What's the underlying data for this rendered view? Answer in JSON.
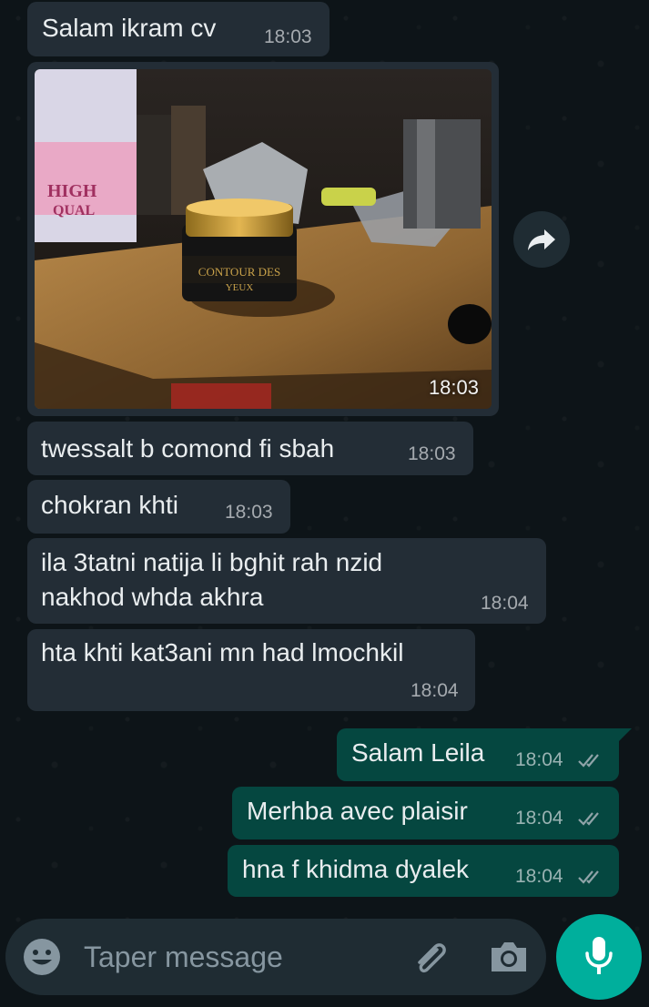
{
  "messages": [
    {
      "direction": "in",
      "text": "Salam ikram cv",
      "time": "18:03"
    },
    {
      "direction": "in",
      "type": "image",
      "alt": "CONTOUR DES YEUX",
      "time": "18:03"
    },
    {
      "direction": "in",
      "text": "twessalt b comond fi sbah",
      "time": "18:03"
    },
    {
      "direction": "in",
      "text": "chokran khti",
      "time": "18:03"
    },
    {
      "direction": "in",
      "text_line1": "ila 3tatni natija li bghit rah nzid",
      "text_line2": "nakhod whda akhra",
      "time": "18:04"
    },
    {
      "direction": "in",
      "text": "hta khti kat3ani mn had lmochkil",
      "time": "18:04"
    },
    {
      "direction": "out",
      "text": "Salam Leila",
      "time": "18:04",
      "status": "read"
    },
    {
      "direction": "out",
      "text": "Merhba avec plaisir",
      "time": "18:04",
      "status": "read"
    },
    {
      "direction": "out",
      "text": "hna f khidma dyalek",
      "time": "18:04",
      "status": "read"
    }
  ],
  "composer": {
    "placeholder": "Taper message"
  },
  "colors": {
    "background": "#0d1418",
    "incoming_bubble": "#232d36",
    "outgoing_bubble": "#054740",
    "accent": "#00af9c",
    "read_ticks": "#8fa3a8"
  },
  "icons": {
    "forward": "forward-icon",
    "emoji": "emoji-icon",
    "attach": "paperclip-icon",
    "camera": "camera-icon",
    "mic": "mic-icon"
  }
}
